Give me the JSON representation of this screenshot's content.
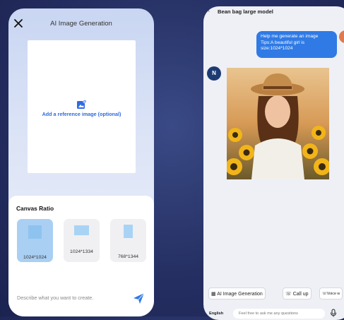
{
  "left": {
    "title": "AI Image Generation",
    "reference_label": "Add a reference image (optional)",
    "canvas_ratio_title": "Canvas Ratio",
    "ratios": [
      {
        "label": "1024*1024",
        "selected": true
      },
      {
        "label": "1024*1334",
        "selected": false
      },
      {
        "label": "768*1344",
        "selected": false
      }
    ],
    "prompt_placeholder": "Describe what you want to create."
  },
  "right": {
    "title": "Bean bag large model",
    "user_message_lines": [
      "Help me generate an image",
      "Tips:A beautiful girl is",
      "size:1024*1024"
    ],
    "bot_avatar_letter": "N",
    "chips": [
      "AI Image Generation",
      "Call up",
      "Voice w"
    ],
    "language": "English",
    "ask_placeholder": "Feel free to ask me any questions"
  },
  "colors": {
    "accent": "#2f7ae5",
    "selected_ratio": "#a9cff3",
    "reference_text": "#2f6be0"
  }
}
